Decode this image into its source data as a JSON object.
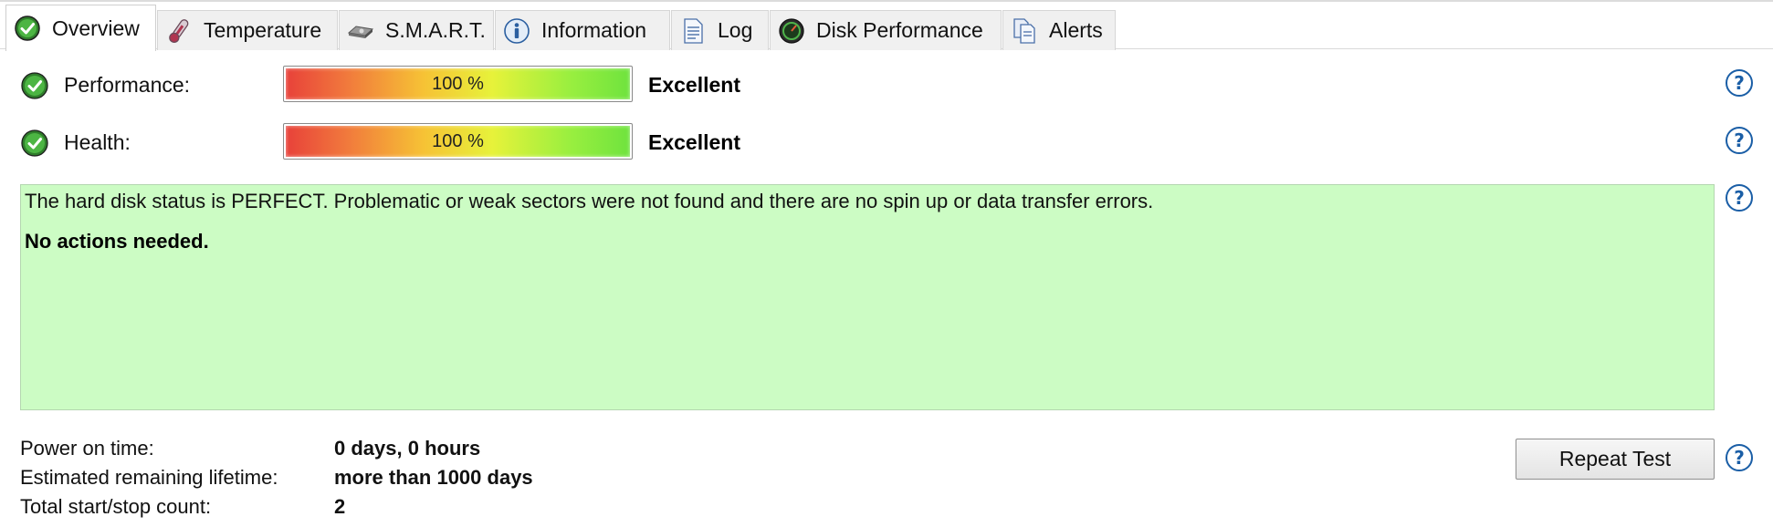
{
  "tabs": [
    {
      "label": "Overview",
      "icon": "check-circle-icon"
    },
    {
      "label": "Temperature",
      "icon": "thermometer-icon"
    },
    {
      "label": "S.M.A.R.T.",
      "icon": "hard-disk-icon"
    },
    {
      "label": "Information",
      "icon": "info-icon"
    },
    {
      "label": "Log",
      "icon": "document-icon"
    },
    {
      "label": "Disk Performance",
      "icon": "gauge-icon"
    },
    {
      "label": "Alerts",
      "icon": "copy-documents-icon"
    }
  ],
  "active_tab": "Overview",
  "performance": {
    "label": "Performance:",
    "value_text": "100 %",
    "value": 100,
    "rating": "Excellent"
  },
  "health": {
    "label": "Health:",
    "value_text": "100 %",
    "value": 100,
    "rating": "Excellent"
  },
  "status": {
    "message": "The hard disk status is PERFECT. Problematic or weak sectors were not found and there are no spin up or data transfer errors.",
    "action": "No actions needed.",
    "background": "#ccfcc4"
  },
  "details": [
    {
      "label": "Power on time:",
      "value": "0 days, 0 hours"
    },
    {
      "label": "Estimated remaining lifetime:",
      "value": "more than 1000 days"
    },
    {
      "label": "Total start/stop count:",
      "value": "2"
    }
  ],
  "repeat_button": "Repeat Test",
  "help_glyph": "?",
  "colors": {
    "accent": "#1a5ea6",
    "check_green": "#3fa33a",
    "bar_low": "#e8413a",
    "bar_high": "#6fe33e"
  }
}
